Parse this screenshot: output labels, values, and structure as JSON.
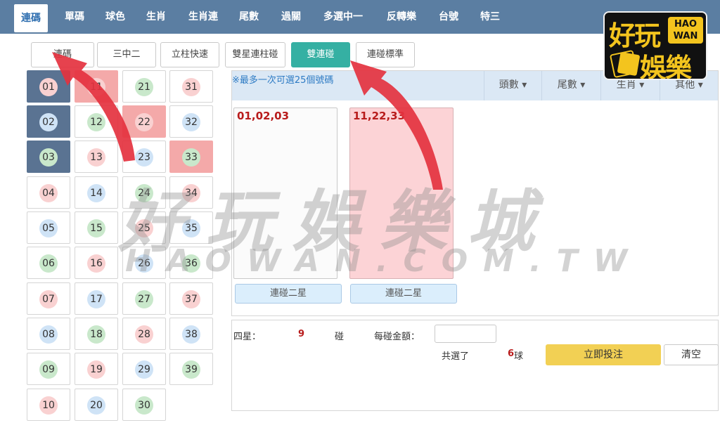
{
  "nav": {
    "tabs": [
      "連碼",
      "單碼",
      "球色",
      "生肖",
      "生肖連",
      "尾數",
      "過關",
      "多選中一",
      "反轉樂",
      "台號",
      "特三"
    ],
    "active": "連碼"
  },
  "logo": {
    "line1": "好玩",
    "line2": "娛樂",
    "badge1": "HAO",
    "badge2": "WAN"
  },
  "subnav": {
    "buttons": [
      "連碼",
      "三中二",
      "立柱快速",
      "雙星連柱碰",
      "雙連碰",
      "連碰標準"
    ],
    "active": "雙連碰"
  },
  "balls": {
    "columns": [
      [
        "01",
        "02",
        "03",
        "04",
        "05",
        "06",
        "07",
        "08",
        "09",
        "10"
      ],
      [
        "11",
        "12",
        "13",
        "14",
        "15",
        "16",
        "17",
        "18",
        "19",
        "20"
      ],
      [
        "21",
        "22",
        "23",
        "24",
        "25",
        "26",
        "27",
        "28",
        "29",
        "30"
      ],
      [
        "31",
        "32",
        "33",
        "34",
        "35",
        "36",
        "37",
        "38",
        "39"
      ]
    ],
    "colors": {
      "01": "red",
      "02": "blue",
      "03": "green",
      "04": "red",
      "05": "blue",
      "06": "green",
      "07": "red",
      "08": "blue",
      "09": "green",
      "10": "red",
      "11": "red",
      "12": "green",
      "13": "red",
      "14": "blue",
      "15": "green",
      "16": "red",
      "17": "blue",
      "18": "green",
      "19": "red",
      "20": "blue",
      "21": "green",
      "22": "red",
      "23": "blue",
      "24": "green",
      "25": "red",
      "26": "blue",
      "27": "green",
      "28": "red",
      "29": "blue",
      "30": "green",
      "31": "red",
      "32": "blue",
      "33": "green",
      "34": "red",
      "35": "blue",
      "36": "green",
      "37": "red",
      "38": "blue",
      "39": "green"
    },
    "selected": [
      "01",
      "02",
      "03"
    ],
    "highlighted": [
      "11",
      "22",
      "33"
    ]
  },
  "panel": {
    "hint": "※最多一次可選25個號碼",
    "dropdowns": [
      "頭數",
      "尾數",
      "生肖",
      "其他"
    ],
    "cards": [
      {
        "combo": "01,02,03",
        "button": "連碰二星"
      },
      {
        "combo": "11,22,33",
        "button": "連碰二星"
      }
    ]
  },
  "form": {
    "stars_label": "四星：",
    "stars_count": "9",
    "pong_label": "碰",
    "amount_label": "每碰金額：",
    "amount_value": "",
    "selected_label": "共選了",
    "selected_count": "6",
    "selected_unit": "球",
    "bet_button": "立即投注",
    "clear_button": "清空"
  },
  "watermark": {
    "line1": "好玩娛樂城",
    "line2": "HAOWAN.COM.TW"
  },
  "colors": {
    "nav_bg": "#5b7ea2",
    "active_tab": "#35b0a3",
    "selected_cell": "#5a7392",
    "highlight_cell": "#f4a9a9",
    "bet_button": "#f2d054",
    "arrow": "#e4323f"
  }
}
